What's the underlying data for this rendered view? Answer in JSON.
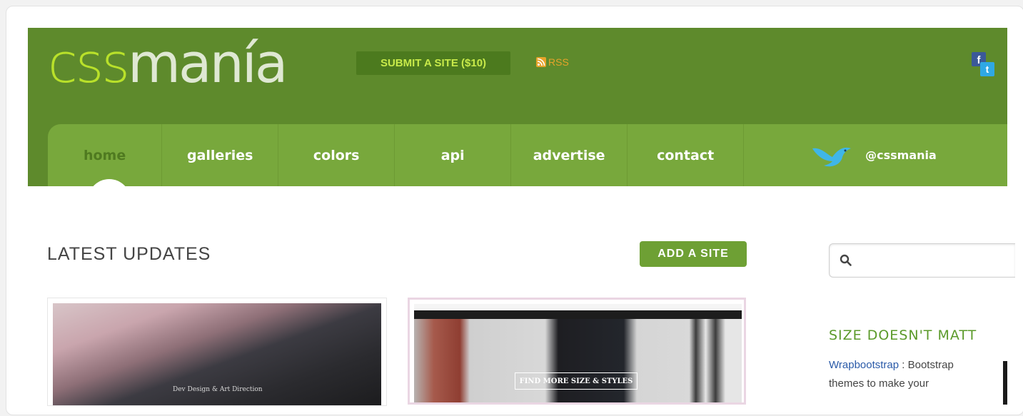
{
  "header": {
    "logo": {
      "css": "css",
      "mania": "manía"
    },
    "submit_button": "SUBMIT A SITE ($10)",
    "rss_label": "RSS",
    "social": {
      "facebook": "f",
      "twitter": "t"
    }
  },
  "nav": {
    "items": [
      {
        "label": "home",
        "active": true
      },
      {
        "label": "galleries"
      },
      {
        "label": "colors"
      },
      {
        "label": "api"
      },
      {
        "label": "advertise"
      },
      {
        "label": "contact"
      }
    ],
    "twitter_handle": "@cssmania"
  },
  "main": {
    "section_title": "LATEST UPDATES",
    "add_site_button": "ADD A SITE",
    "thumbnails": [
      {
        "caption": "Dev Design & Art Direction"
      },
      {
        "caption": "FIND MORE SIZE & STYLES"
      }
    ]
  },
  "sidebar": {
    "search_placeholder": "",
    "ad_title": "SIZE DOESN'T MATT",
    "ad_link": "Wrapbootstrap",
    "ad_text_1": " : Bootstrap",
    "ad_text_2": "themes to make your"
  },
  "colors": {
    "header_green": "#5e8a2c",
    "nav_green": "#78a83c",
    "accent_lime": "#b9e12a",
    "rss_orange": "#e6a32a"
  }
}
